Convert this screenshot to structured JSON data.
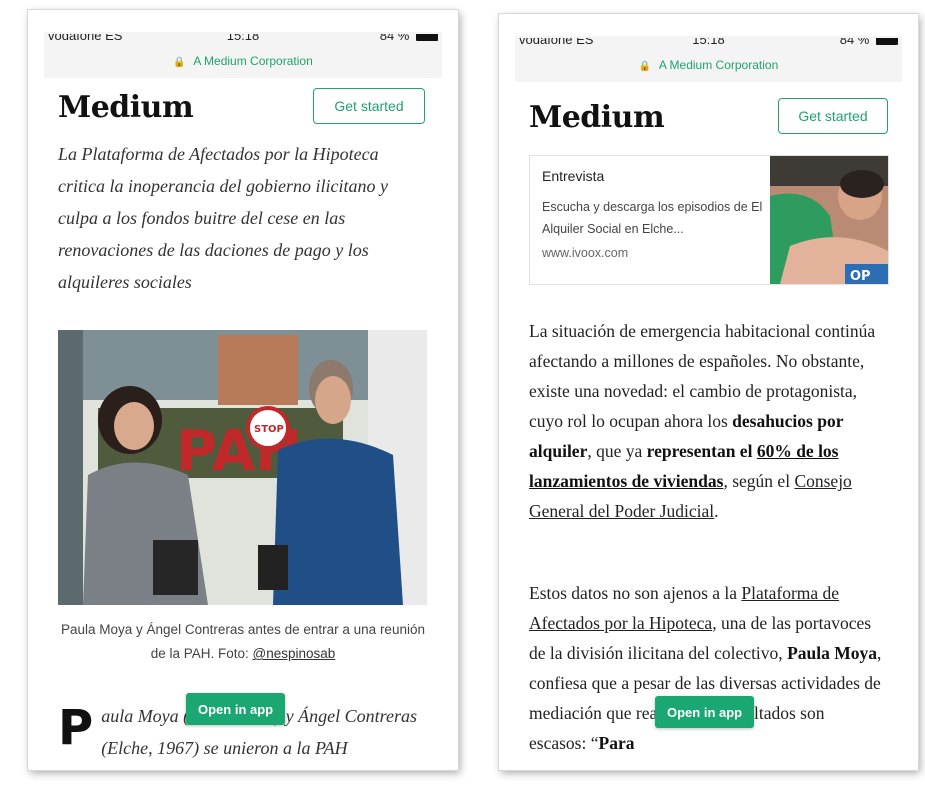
{
  "left_screen": {
    "status_bar": {
      "carrier": "vodafone ES",
      "time": "15:18",
      "battery": "84 %"
    },
    "site_label": "A Medium Corporation",
    "logo": "Medium",
    "get_started": "Get started",
    "subtitle": "La Plataforma de Afectados por la Hipoteca critica la inoperancia del gobierno ilicitano y culpa a los fondos buitre del cese en las renovaciones de las daciones de pago y los alquileres sociales",
    "photo_sign": "PAH",
    "photo_stop": "STOP",
    "caption": "Paula Moya y Ángel Contreras antes de entrar a una reunión de la PAH. Foto: ",
    "caption_mention": "@nespinosab",
    "dropcap": "P",
    "para_text": "aula Moya (Elche, 1974) y Ángel Contreras (Elche, 1967) se unieron a la PAH",
    "open_in_app": "Open in app"
  },
  "right_screen": {
    "status_bar": {
      "carrier": "vodafone ES",
      "time": "15:18",
      "battery": "84 %"
    },
    "site_label": "A Medium Corporation",
    "logo": "Medium",
    "get_started": "Get started",
    "card": {
      "title": "Entrevista",
      "description": "Escucha y descarga los episodios de El Alquiler Social en Elche...",
      "domain": "www.ivoox.com",
      "thumb_sign": "OP"
    },
    "para1": {
      "t1": "La situación de emergencia habitacional continúa afectando a millones de españoles. No obstante, existe una novedad: el cambio de protagonista, cuyo rol lo ocupan ahora los ",
      "b1": "desahucios por alquiler",
      "t2": ", que ya ",
      "b2": "representan el ",
      "b3_link": "60% de los lanzamientos de viviendas",
      "t3": ", según el ",
      "link1": "Consejo General del Poder Judicial",
      "t4": "."
    },
    "para2": {
      "t1": "Estos datos no son ajenos a la ",
      "link1": "Plataforma de Afectados por la Hipoteca",
      "t2": ", una de las portavoces de la división ilicitana del colectivo, ",
      "b1": "Paula Moya",
      "t3": ", confiesa que a pesar de las diversas actividades de mediación que realizan, los resultados son escasos: “",
      "b2": "Para"
    },
    "open_in_app": "Open in app"
  },
  "colors": {
    "accent_green": "#1fa36b",
    "open_app_green": "#1aa771",
    "status_bar_bg": "#f4f4f4"
  }
}
